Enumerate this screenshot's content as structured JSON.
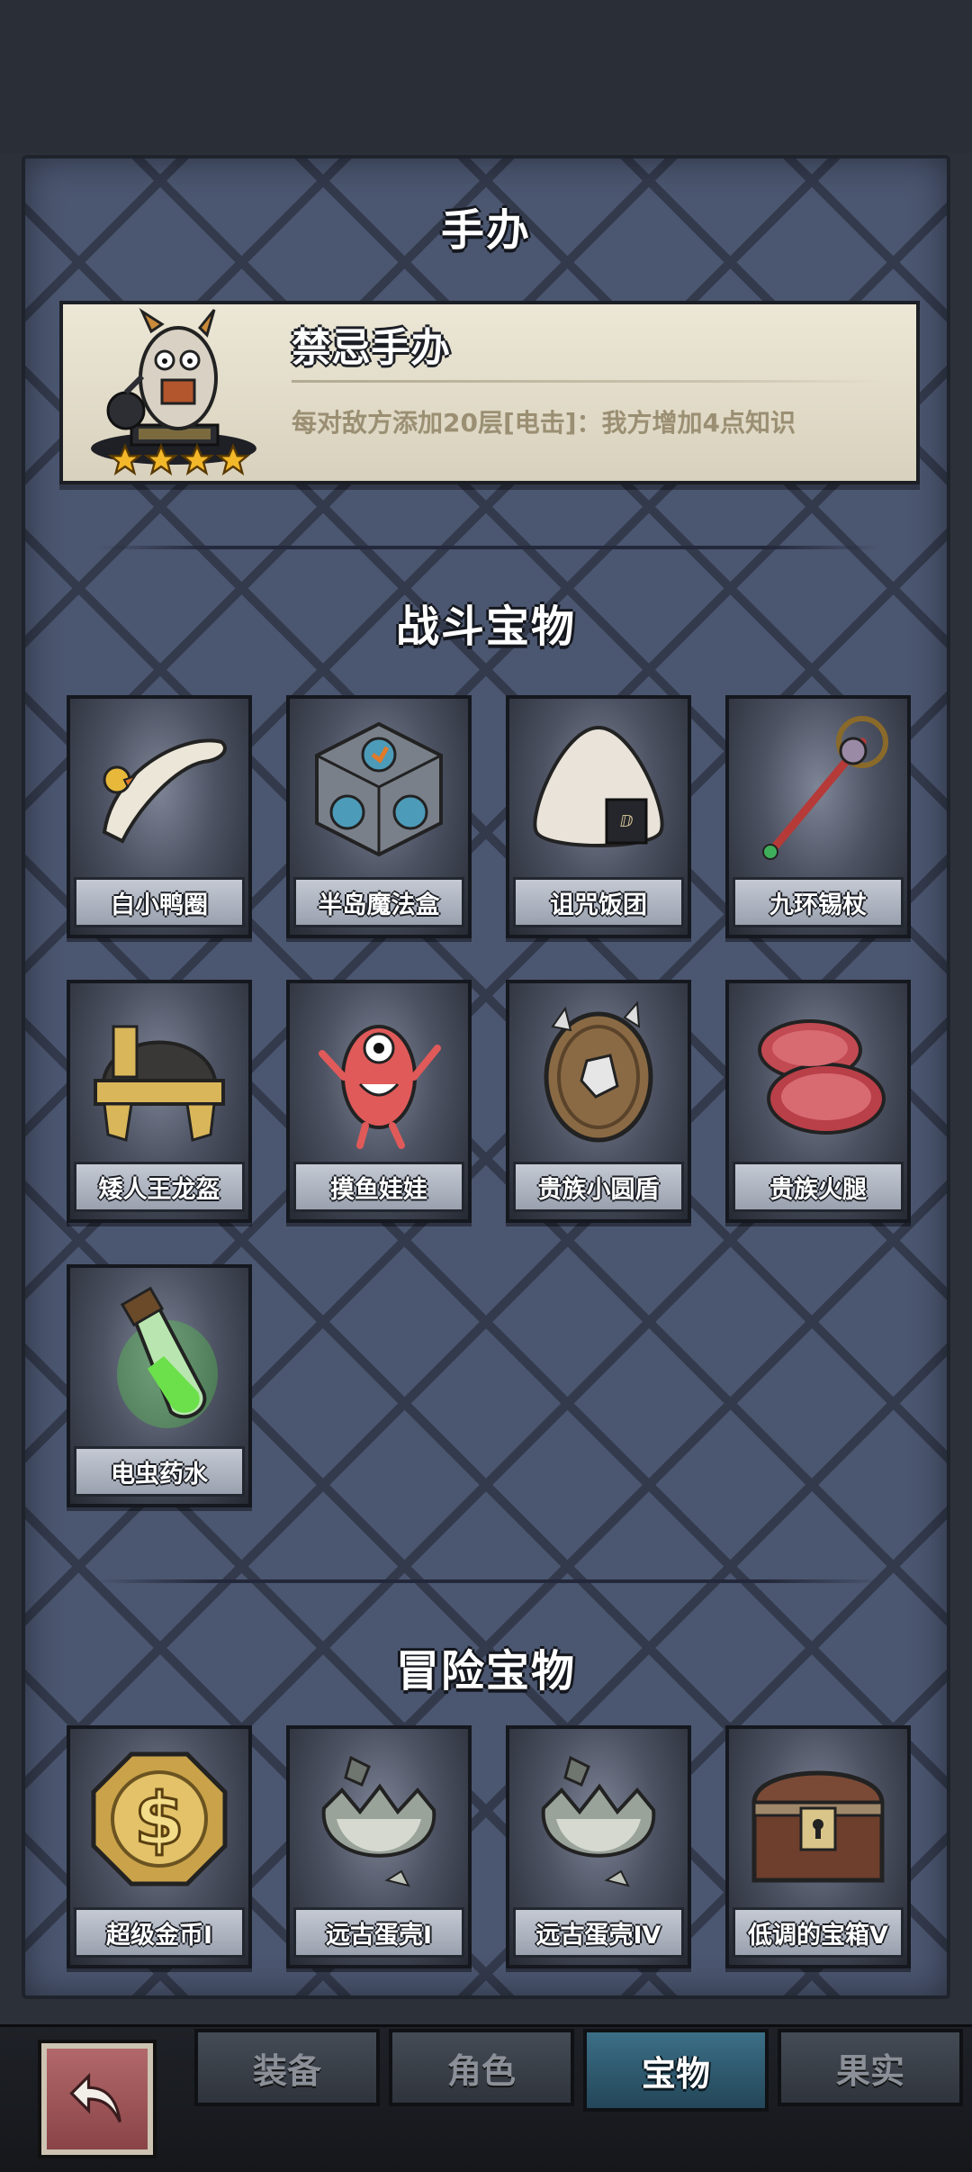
{
  "figure_section": {
    "title": "手办",
    "figure": {
      "name": "禁忌手办",
      "description": "每对敌方添加20层[电击]：我方增加4点知识",
      "stars": 4
    }
  },
  "combat_section": {
    "title": "战斗宝物",
    "items": [
      {
        "name": "白小鸭圈",
        "icon": "duck-ring-icon"
      },
      {
        "name": "半岛魔法盒",
        "icon": "magic-box-icon"
      },
      {
        "name": "诅咒饭团",
        "icon": "rice-ball-icon"
      },
      {
        "name": "九环锡杖",
        "icon": "staff-icon"
      },
      {
        "name": "矮人王龙盔",
        "icon": "helmet-icon"
      },
      {
        "name": "摸鱼娃娃",
        "icon": "doll-icon"
      },
      {
        "name": "贵族小圆盾",
        "icon": "shield-icon"
      },
      {
        "name": "贵族火腿",
        "icon": "ham-icon"
      },
      {
        "name": "电虫药水",
        "icon": "potion-icon"
      }
    ]
  },
  "adventure_section": {
    "title": "冒险宝物",
    "items": [
      {
        "name": "超级金币I",
        "icon": "gold-coin-icon"
      },
      {
        "name": "远古蛋壳I",
        "icon": "eggshell-icon"
      },
      {
        "name": "远古蛋壳IV",
        "icon": "eggshell-icon"
      },
      {
        "name": "低调的宝箱V",
        "icon": "treasure-chest-icon"
      }
    ]
  },
  "bottom_nav": {
    "back_icon": "back-arrow-icon",
    "tabs": [
      {
        "label": "装备",
        "active": false
      },
      {
        "label": "角色",
        "active": false
      },
      {
        "label": "宝物",
        "active": true
      },
      {
        "label": "果实",
        "active": false
      }
    ]
  }
}
